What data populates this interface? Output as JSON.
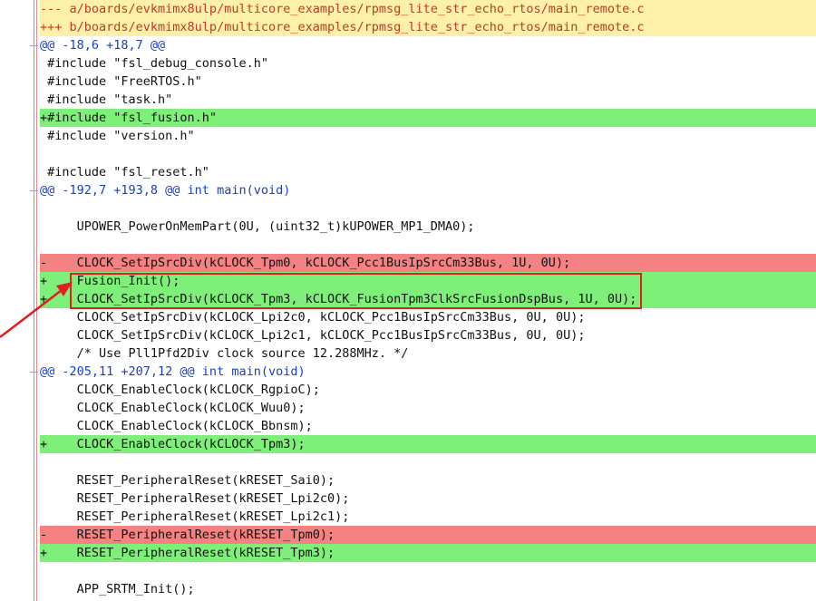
{
  "diff": {
    "lines": [
      {
        "type": "header",
        "text": "--- a/boards/evkmimx8ulp/multicore_examples/rpmsg_lite_str_echo_rtos/main_remote.c"
      },
      {
        "type": "header",
        "text": "+++ b/boards/evkmimx8ulp/multicore_examples/rpmsg_lite_str_echo_rtos/main_remote.c"
      },
      {
        "type": "hunk",
        "text": "@@ -18,6 +18,7 @@"
      },
      {
        "type": "context",
        "text": " #include \"fsl_debug_console.h\""
      },
      {
        "type": "context",
        "text": " #include \"FreeRTOS.h\""
      },
      {
        "type": "context",
        "text": " #include \"task.h\""
      },
      {
        "type": "add",
        "text": "+#include \"fsl_fusion.h\""
      },
      {
        "type": "context",
        "text": " #include \"version.h\""
      },
      {
        "type": "context",
        "text": ""
      },
      {
        "type": "context",
        "text": " #include \"fsl_reset.h\""
      },
      {
        "type": "hunk",
        "text": "@@ -192,7 +193,8 @@ int main(void)"
      },
      {
        "type": "context",
        "text": ""
      },
      {
        "type": "context",
        "text": "     UPOWER_PowerOnMemPart(0U, (uint32_t)kUPOWER_MP1_DMA0);"
      },
      {
        "type": "context",
        "text": ""
      },
      {
        "type": "del",
        "text": "-    CLOCK_SetIpSrcDiv(kCLOCK_Tpm0, kCLOCK_Pcc1BusIpSrcCm33Bus, 1U, 0U);"
      },
      {
        "type": "add",
        "text": "+    Fusion_Init();"
      },
      {
        "type": "add",
        "text": "+    CLOCK_SetIpSrcDiv(kCLOCK_Tpm3, kCLOCK_FusionTpm3ClkSrcFusionDspBus, 1U, 0U);"
      },
      {
        "type": "context",
        "text": "     CLOCK_SetIpSrcDiv(kCLOCK_Lpi2c0, kCLOCK_Pcc1BusIpSrcCm33Bus, 0U, 0U);"
      },
      {
        "type": "context",
        "text": "     CLOCK_SetIpSrcDiv(kCLOCK_Lpi2c1, kCLOCK_Pcc1BusIpSrcCm33Bus, 0U, 0U);"
      },
      {
        "type": "context",
        "text": "     /* Use Pll1Pfd2Div clock source 12.288MHz. */"
      },
      {
        "type": "hunk",
        "text": "@@ -205,11 +207,12 @@ int main(void)"
      },
      {
        "type": "context",
        "text": "     CLOCK_EnableClock(kCLOCK_RgpioC);"
      },
      {
        "type": "context",
        "text": "     CLOCK_EnableClock(kCLOCK_Wuu0);"
      },
      {
        "type": "context",
        "text": "     CLOCK_EnableClock(kCLOCK_Bbnsm);"
      },
      {
        "type": "add",
        "text": "+    CLOCK_EnableClock(kCLOCK_Tpm3);"
      },
      {
        "type": "context",
        "text": ""
      },
      {
        "type": "context",
        "text": "     RESET_PeripheralReset(kRESET_Sai0);"
      },
      {
        "type": "context",
        "text": "     RESET_PeripheralReset(kRESET_Lpi2c0);"
      },
      {
        "type": "context",
        "text": "     RESET_PeripheralReset(kRESET_Lpi2c1);"
      },
      {
        "type": "del",
        "text": "-    RESET_PeripheralReset(kRESET_Tpm0);"
      },
      {
        "type": "add",
        "text": "+    RESET_PeripheralReset(kRESET_Tpm3);"
      },
      {
        "type": "context",
        "text": ""
      },
      {
        "type": "context",
        "text": "     APP_SRTM_Init();"
      }
    ]
  },
  "colors": {
    "header_bg": "#fdf0a8",
    "header_text": "#c0392b",
    "hunk_text": "#1a3fc7",
    "add_bg": "#7ef07a",
    "del_bg": "#f58282",
    "annotation": "#e02020"
  }
}
